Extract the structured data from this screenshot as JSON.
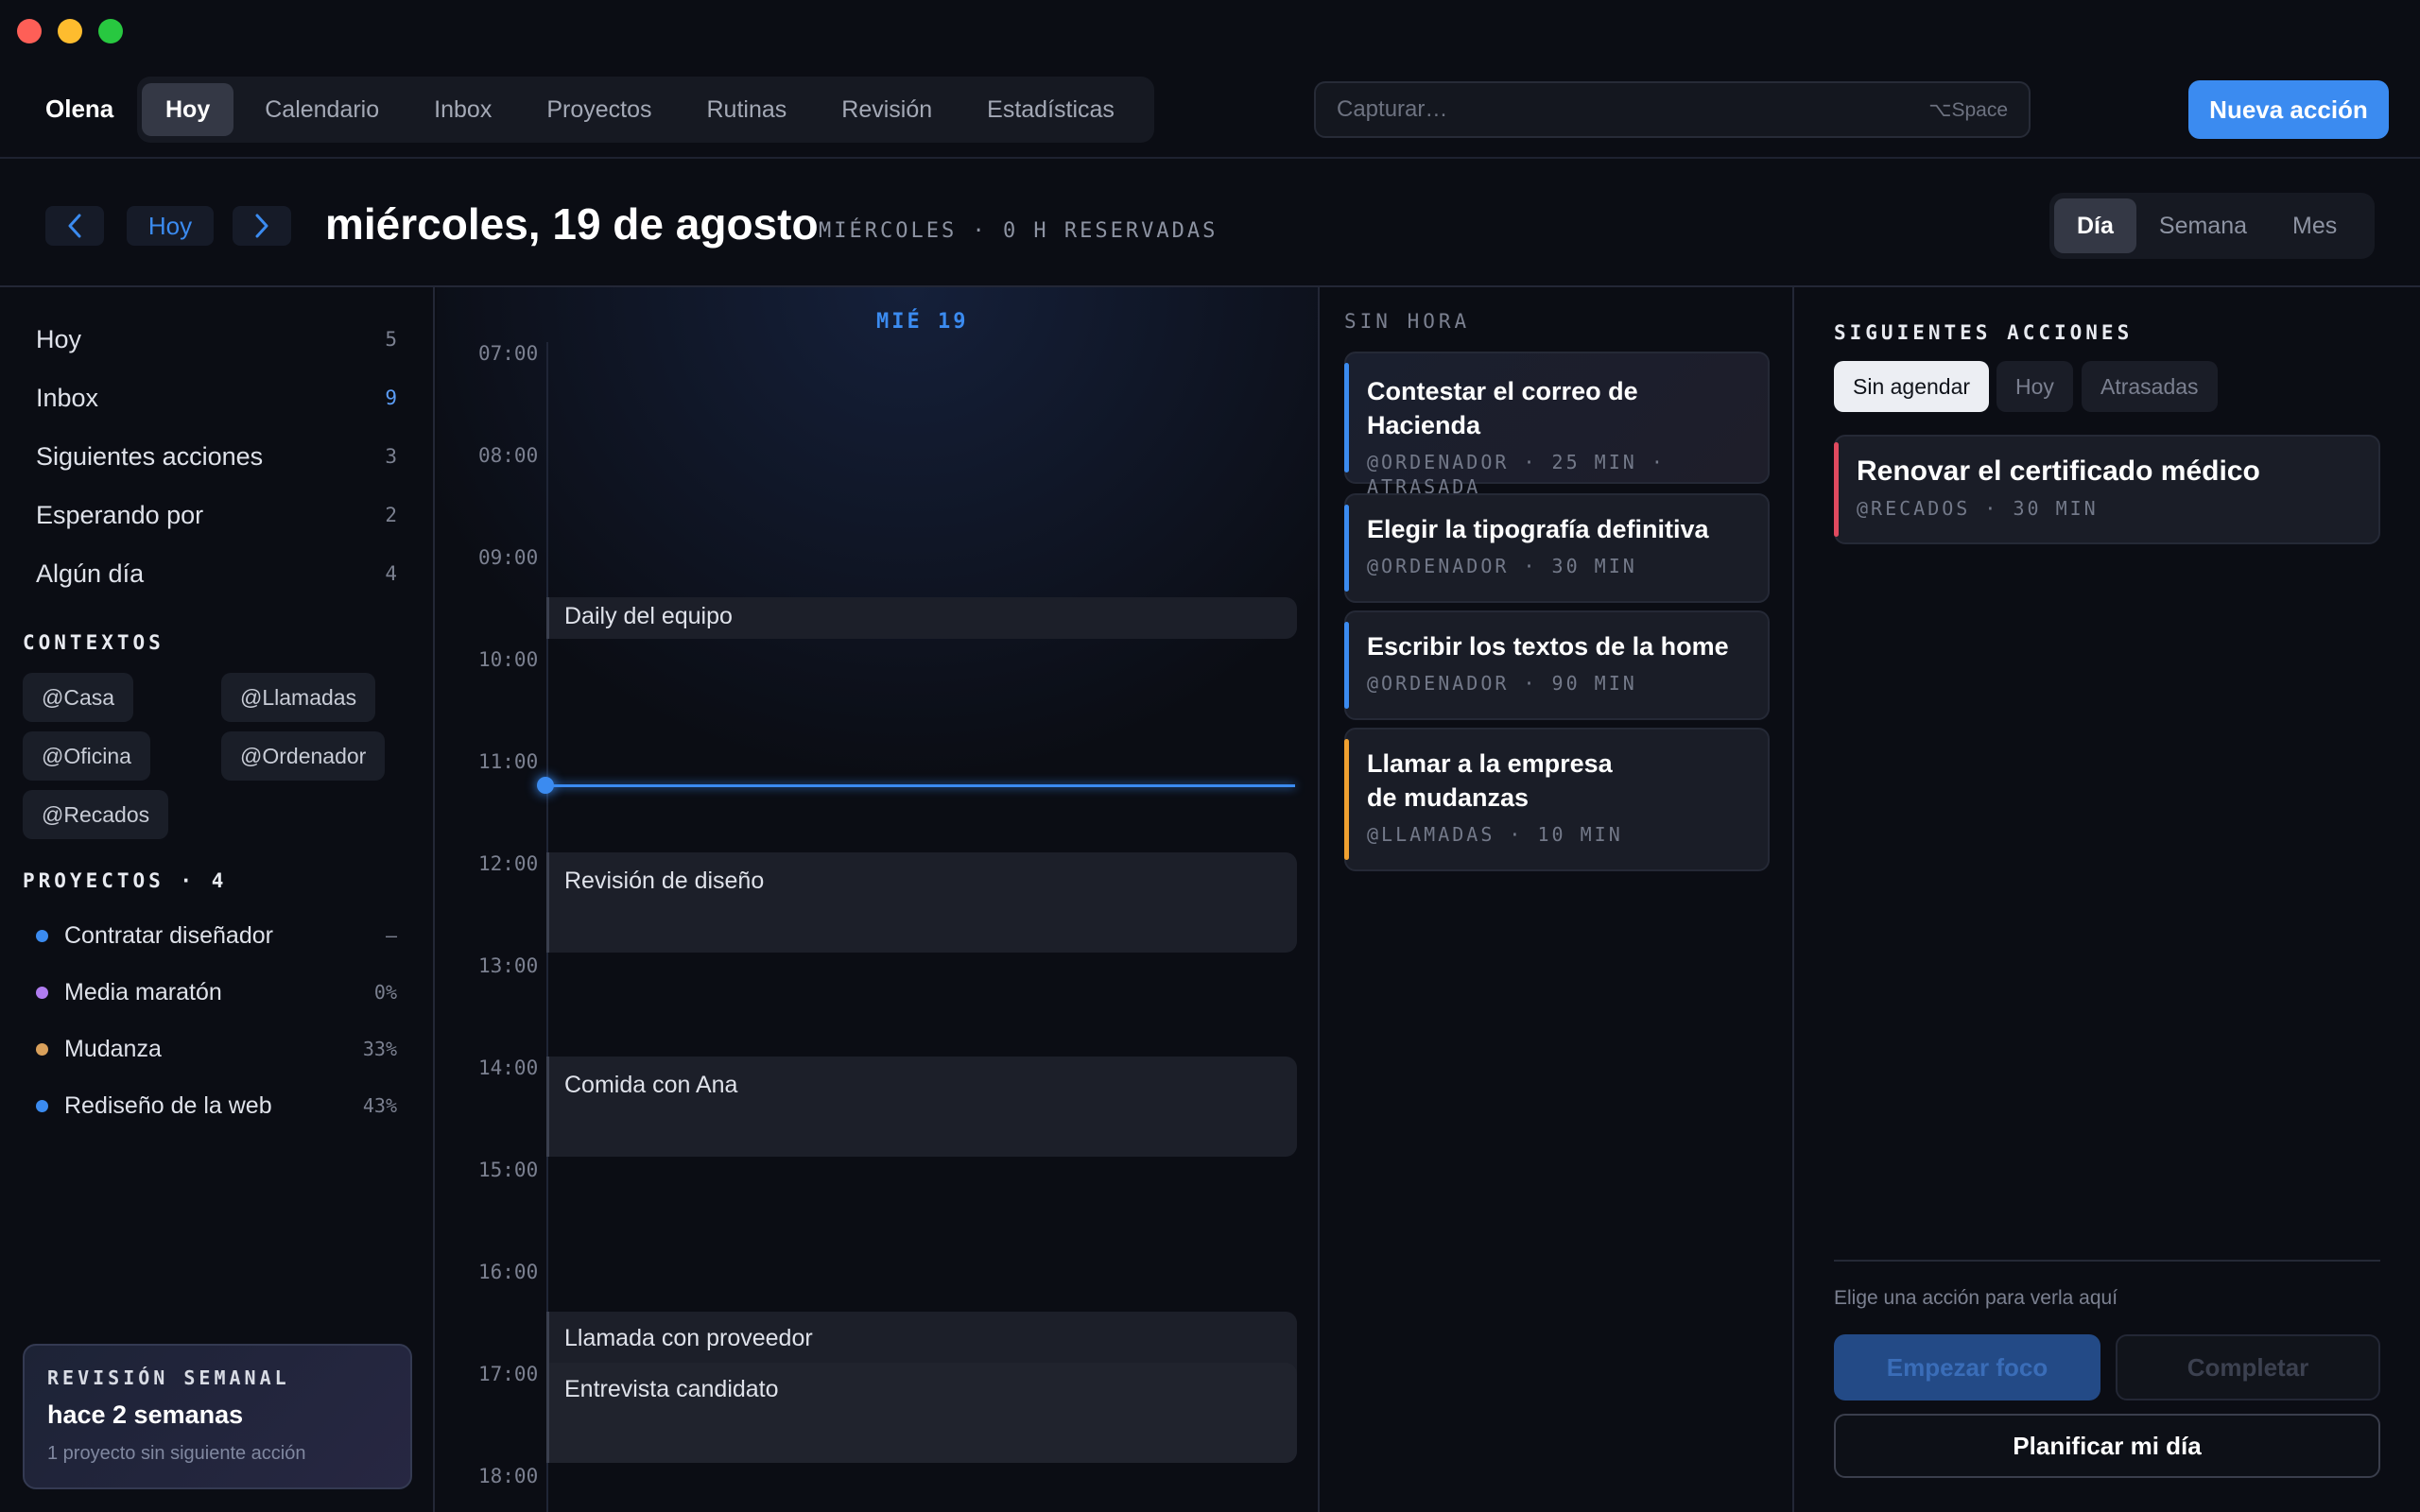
{
  "window": {
    "controls": [
      "close",
      "minimize",
      "maximize"
    ]
  },
  "topbar": {
    "brand": "Olena",
    "tabs": [
      {
        "label": "Hoy",
        "active": true
      },
      {
        "label": "Calendario",
        "active": false
      },
      {
        "label": "Inbox",
        "active": false
      },
      {
        "label": "Proyectos",
        "active": false
      },
      {
        "label": "Rutinas",
        "active": false
      },
      {
        "label": "Revisión",
        "active": false
      },
      {
        "label": "Estadísticas",
        "active": false
      }
    ],
    "search": {
      "placeholder": "Capturar…",
      "shortcut": "⌥Space"
    },
    "primary_button": "Nueva acción"
  },
  "datebar": {
    "prev_icon": "chevron-left-icon",
    "today_label": "Hoy",
    "next_icon": "chevron-right-icon",
    "title": "miércoles, 19 de agosto",
    "subtitle": "MIÉRCOLES · 0 H RESERVADAS",
    "views": [
      {
        "label": "Día",
        "active": true
      },
      {
        "label": "Semana",
        "active": false
      },
      {
        "label": "Mes",
        "active": false
      }
    ]
  },
  "sidebar": {
    "lists": [
      {
        "label": "Hoy",
        "count": "5"
      },
      {
        "label": "Inbox",
        "count": "9"
      },
      {
        "label": "Siguientes acciones",
        "count": "3"
      },
      {
        "label": "Esperando por",
        "count": "2"
      },
      {
        "label": "Algún día",
        "count": "4"
      }
    ],
    "contexts_heading": "CONTEXTOS",
    "contexts": [
      "@Casa",
      "@Llamadas",
      "@Oficina",
      "@Ordenador",
      "@Recados"
    ],
    "projects_heading": "PROYECTOS · 4",
    "projects": [
      {
        "name": "Contratar diseñador",
        "progress": "–",
        "color": "#3b8bf0"
      },
      {
        "name": "Media maratón",
        "progress": "0%",
        "color": "#b07cf0"
      },
      {
        "name": "Mudanza",
        "progress": "33%",
        "color": "#d9a05b"
      },
      {
        "name": "Rediseño de la web",
        "progress": "43%",
        "color": "#3b8bf0"
      }
    ],
    "review": {
      "kicker": "REVISIÓN SEMANAL",
      "title": "hace 2 semanas",
      "subtitle": "1 proyecto sin siguiente acción"
    }
  },
  "calendar": {
    "day_label": "MIÉ 19",
    "hours": [
      "07:00",
      "08:00",
      "09:00",
      "10:00",
      "11:00",
      "12:00",
      "13:00",
      "14:00",
      "15:00",
      "16:00",
      "17:00",
      "18:00"
    ],
    "events": [
      {
        "title": "Daily del equipo"
      },
      {
        "title": "Revisión de diseño"
      },
      {
        "title": "Comida con Ana"
      },
      {
        "title": "Llamada con proveedor"
      },
      {
        "title": "Entrevista candidato"
      }
    ]
  },
  "unscheduled": {
    "heading": "SIN HORA",
    "tasks": [
      {
        "title": "Contestar el correo de Hacienda",
        "meta": "@ORDENADOR · 25 MIN · ATRASADA",
        "color": "#3b8bf0"
      },
      {
        "title": "Elegir la tipografía definitiva",
        "meta": "@ORDENADOR · 30 MIN",
        "color": "#3b8bf0"
      },
      {
        "title": "Escribir los textos de la home",
        "meta": "@ORDENADOR · 90 MIN",
        "color": "#3b8bf0"
      },
      {
        "title": "Llamar a la empresa de mudanzas",
        "meta": "@LLAMADAS · 10 MIN",
        "color": "#f0a030"
      }
    ]
  },
  "next_actions": {
    "heading": "SIGUIENTES ACCIONES",
    "filters": [
      {
        "label": "Sin agendar",
        "active": true
      },
      {
        "label": "Hoy",
        "active": false
      },
      {
        "label": "Atrasadas",
        "active": false
      }
    ],
    "items": [
      {
        "title": "Renovar el certificado médico",
        "meta": "@RECADOS · 30 MIN",
        "color": "#e04a5f"
      }
    ],
    "hint": "Elige una acción para verla aquí",
    "start_focus": "Empezar foco",
    "complete": "Completar",
    "plan_day": "Planificar mi día"
  }
}
